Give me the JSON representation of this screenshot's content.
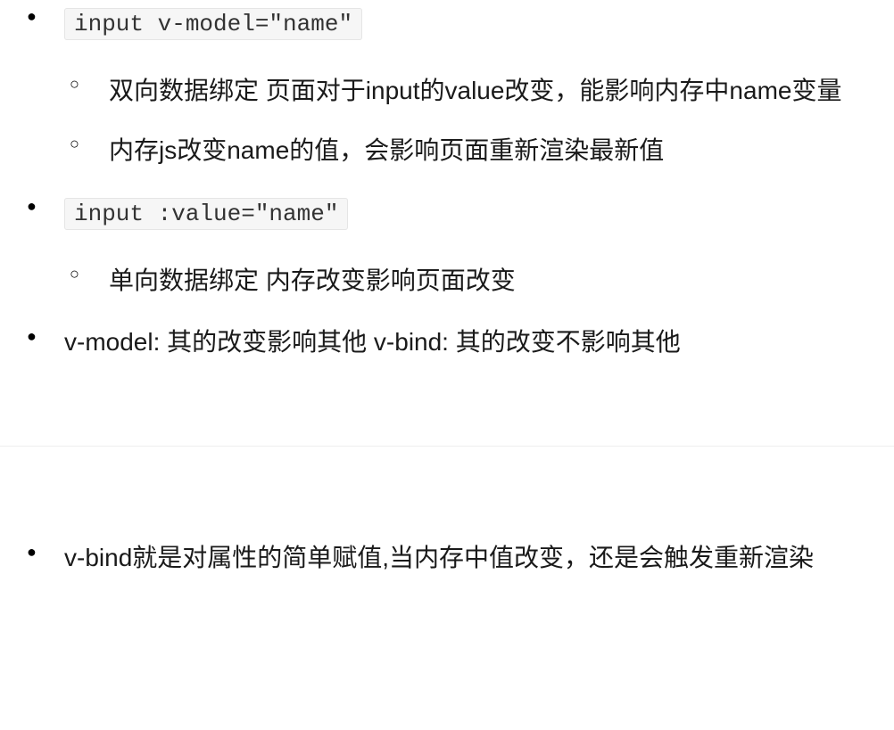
{
  "section1": {
    "items": [
      {
        "code": "input v-model=\"name\"",
        "sub": [
          "双向数据绑定  页面对于input的value改变，能影响内存中name变量",
          "内存js改变name的值，会影响页面重新渲染最新值"
        ]
      },
      {
        "code": "input :value=\"name\"",
        "sub": [
          "单向数据绑定 内存改变影响页面改变"
        ]
      },
      {
        "text": "v-model: 其的改变影响其他 v-bind: 其的改变不影响其他"
      }
    ]
  },
  "section2": {
    "items": [
      {
        "text": "v-bind就是对属性的简单赋值,当内存中值改变，还是会触发重新渲染"
      }
    ]
  }
}
